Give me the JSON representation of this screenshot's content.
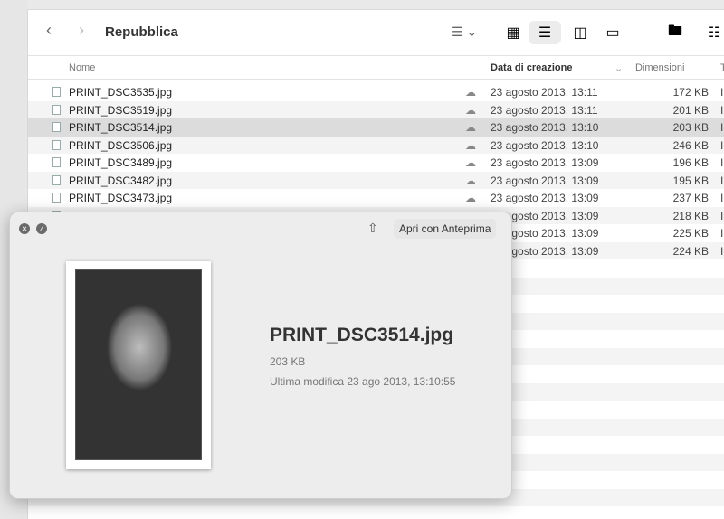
{
  "window": {
    "title": "Repubblica"
  },
  "columns": {
    "name": "Nome",
    "created": "Data di creazione",
    "size": "Dimensioni",
    "kind": "T"
  },
  "files": [
    {
      "name": "PRINT_DSC3535.jpg",
      "created": "23 agosto 2013, 13:11",
      "size": "172 KB",
      "kind": "I"
    },
    {
      "name": "PRINT_DSC3519.jpg",
      "created": "23 agosto 2013, 13:11",
      "size": "201 KB",
      "kind": "I"
    },
    {
      "name": "PRINT_DSC3514.jpg",
      "created": "23 agosto 2013, 13:10",
      "size": "203 KB",
      "kind": "I",
      "selected": true
    },
    {
      "name": "PRINT_DSC3506.jpg",
      "created": "23 agosto 2013, 13:10",
      "size": "246 KB",
      "kind": "I"
    },
    {
      "name": "PRINT_DSC3489.jpg",
      "created": "23 agosto 2013, 13:09",
      "size": "196 KB",
      "kind": "I"
    },
    {
      "name": "PRINT_DSC3482.jpg",
      "created": "23 agosto 2013, 13:09",
      "size": "195 KB",
      "kind": "I"
    },
    {
      "name": "PRINT_DSC3473.jpg",
      "created": "23 agosto 2013, 13:09",
      "size": "237 KB",
      "kind": "I"
    },
    {
      "name": "",
      "created": "23 agosto 2013, 13:09",
      "size": "218 KB",
      "kind": "I"
    },
    {
      "name": "",
      "created": "23 agosto 2013, 13:09",
      "size": "225 KB",
      "kind": "I"
    },
    {
      "name": "",
      "created": "23 agosto 2013, 13:09",
      "size": "224 KB",
      "kind": "I"
    }
  ],
  "quicklook": {
    "open_button": "Apri con Anteprima",
    "filename": "PRINT_DSC3514.jpg",
    "size": "203 KB",
    "modified": "Ultima modifica 23 ago 2013, 13:10:55"
  }
}
